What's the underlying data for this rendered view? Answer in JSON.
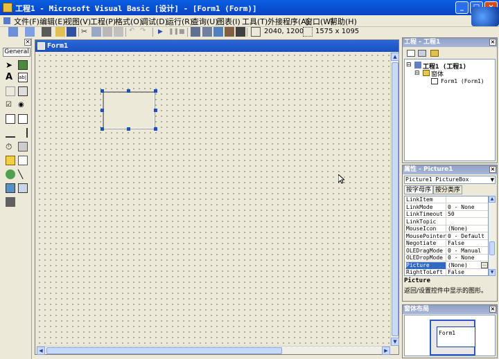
{
  "window": {
    "title": "工程1 - Microsoft Visual Basic [设计] - [Form1 (Form)]",
    "minimize_icon": "minimize-icon",
    "maximize_icon": "maximize-icon",
    "close_icon": "close-icon"
  },
  "menu": {
    "items": [
      "文件(F)",
      "编辑(E)",
      "视图(V)",
      "工程(P)",
      "格式(O)",
      "调试(D)",
      "运行(R)",
      "查询(U)",
      "图表(I)",
      "工具(T)",
      "外接程序(A)",
      "窗口(W)",
      "帮助(H)"
    ]
  },
  "toolbar": {
    "position": "2040, 1200",
    "size": "1575 x 1095"
  },
  "toolbox": {
    "tab_label": "General"
  },
  "form_window": {
    "title": "Form1"
  },
  "project": {
    "title": "工程 - 工程1",
    "root": "工程1 (工程1)",
    "folder": "窗体",
    "item": "Form1 (Form1)"
  },
  "properties": {
    "title": "属性 - Picture1",
    "object": "Picture1 PictureBox",
    "tab_alpha": "按字母序",
    "tab_category": "按分类序",
    "rows": [
      {
        "name": "LinkItem",
        "value": ""
      },
      {
        "name": "LinkMode",
        "value": "0 - None"
      },
      {
        "name": "LinkTimeout",
        "value": "50"
      },
      {
        "name": "LinkTopic",
        "value": ""
      },
      {
        "name": "MouseIcon",
        "value": "(None)"
      },
      {
        "name": "MousePointer",
        "value": "0 - Default"
      },
      {
        "name": "Negotiate",
        "value": "False"
      },
      {
        "name": "OLEDragMode",
        "value": "0 - Manual"
      },
      {
        "name": "OLEDropMode",
        "value": "0 - None"
      },
      {
        "name": "Picture",
        "value": "(None)"
      },
      {
        "name": "RightToLeft",
        "value": "False"
      }
    ],
    "selected_name": "Picture",
    "desc_title": "Picture",
    "desc_text": "返回/设置控件中显示的图形。"
  },
  "layout": {
    "title": "窗体布局",
    "form_label": "Form1"
  }
}
